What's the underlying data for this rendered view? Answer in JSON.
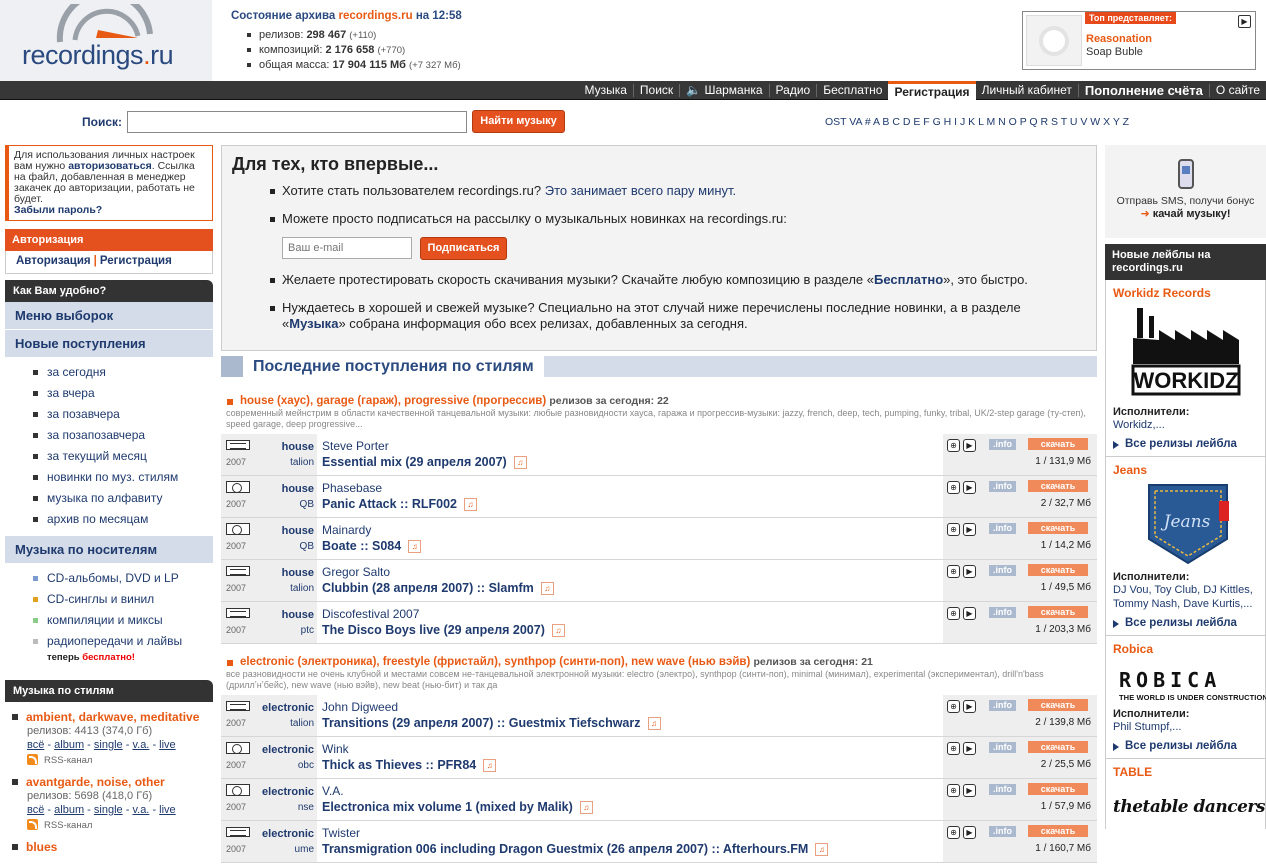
{
  "logo": {
    "text": "recordings",
    "dot": ".",
    "tld": "ru"
  },
  "archive": {
    "title_prefix": "Состояние архива",
    "site": "recordings.ru",
    "time_prefix": "на",
    "time": "12:58",
    "stats": [
      {
        "label": "релизов:",
        "value": "298 467",
        "delta": "(+110)"
      },
      {
        "label": "композиций:",
        "value": "2 176 658",
        "delta": "(+770)"
      },
      {
        "label": "общая масса:",
        "value": "17 904 115 Мб",
        "delta": "(+7 327 Мб)"
      }
    ]
  },
  "top": {
    "tag": "Топ представляет:",
    "artist": "Reasonation",
    "track": "Soap Buble"
  },
  "nav": {
    "items": [
      "Музыка",
      "Поиск",
      "Шарманка",
      "Радио",
      "Бесплатно",
      "Регистрация",
      "Личный кабинет",
      "Пополнение счёта",
      "О сайте"
    ],
    "selected": "Регистрация"
  },
  "search": {
    "label": "Поиск:",
    "value": "",
    "placeholder": "",
    "button": "Найти музыку",
    "alphabet": "OST VA # A B C D E F G H I J K L M N O P Q R S T U V W X Y Z"
  },
  "left": {
    "note_p1": "Для использования личных настроек вам нужно",
    "note_link": "авторизоваться",
    "note_p2": ". Ссылка на файл, добавленная в менеджер закачек до авторизации, работать не будет.",
    "forgot": "Забыли пароль?",
    "auth_head": "Авторизация",
    "auth_link1": "Авторизация",
    "auth_sep": "|",
    "auth_link2": "Регистрация",
    "how_head": "Как Вам удобно?",
    "menu": "Меню выборок",
    "new_head": "Новые поступления",
    "new_items": [
      "за сегодня",
      "за вчера",
      "за позавчера",
      "за позапозавчера",
      "за текущий месяц",
      "новинки по муз. стилям",
      "музыка по алфавиту",
      "архив по месяцам"
    ],
    "media_head": "Музыка по носителям",
    "media_items": [
      "CD-альбомы, DVD и LP",
      "CD-синглы и винил",
      "компиляции и миксы",
      "радиопередачи и лайвы"
    ],
    "free_prefix": "теперь",
    "free_word": "бесплатно!",
    "styles_head": "Музыка по стилям",
    "styles": [
      {
        "name": "ambient, darkwave, meditative",
        "meta": "релизов: 4413 (374,0 Гб)",
        "rss": "RSS-канал"
      },
      {
        "name": "avantgarde, noise, other",
        "meta": "релизов: 5698 (418,0 Гб)",
        "rss": "RSS-канал"
      },
      {
        "name": "blues",
        "meta": "",
        "rss": ""
      }
    ],
    "style_links": [
      "всё",
      "album",
      "single",
      "v.a.",
      "live"
    ],
    "style_link_sep": "-"
  },
  "welcome": {
    "title": "Для тех, кто впервые...",
    "b1_text": "Хотите стать пользователем recordings.ru?",
    "b1_link": "Это занимает всего пару минут.",
    "b2_text": "Можете просто подписаться на рассылку о музыкальных новинках на recordings.ru:",
    "email_placeholder": "Ваш e-mail",
    "subscribe": "Подписаться",
    "b3_p1": "Желаете протестировать скорость скачивания музыки? Скачайте любую композицию в разделе «",
    "b3_link": "Бесплатно",
    "b3_p2": "», это быстро.",
    "b4_p1": "Нуждаетесь в хорошей и свежей музыке? Специально на этот случай ниже перечислены последние новинки, а в разделе «",
    "b4_link": "Музыка",
    "b4_p2": "» собрана информация обо всех релизах, добавленных за сегодня."
  },
  "latest": {
    "title": "Последние поступления по стилям",
    "info_label": ".info",
    "download_label": "скачать",
    "genres": [
      {
        "title": "house (хаус), garage (гараж), progressive (прогрессив)",
        "count": "релизов за сегодня: 22",
        "desc": "современный мейнстрим в области качественной танцевальной музыки: любые разновидности хауса, гаража и прогрессив-музыки: jazzy, french, deep, tech, pumping, funky, tribal, UK/2-step garage (ту-степ), speed garage, deep progressive...",
        "releases": [
          {
            "media": "tape",
            "year": "2007",
            "genre": "house",
            "label": "talion",
            "artist": "Steve Porter",
            "title": "Essential mix (29 апреля 2007)",
            "size": "1 / 131,9 Мб"
          },
          {
            "media": "vinyl",
            "year": "2007",
            "genre": "house",
            "label": "QB",
            "artist": "Phasebase",
            "title": "Panic Attack :: RLF002",
            "size": "2 / 32,7 Мб"
          },
          {
            "media": "vinyl",
            "year": "2007",
            "genre": "house",
            "label": "QB",
            "artist": "Mainardy",
            "title": "Boate :: S084",
            "size": "1 / 14,2 Мб"
          },
          {
            "media": "tape",
            "year": "2007",
            "genre": "house",
            "label": "talion",
            "artist": "Gregor Salto",
            "title": "Clubbin (28 апреля 2007) :: Slamfm",
            "size": "1 / 49,5 Мб"
          },
          {
            "media": "tape",
            "year": "2007",
            "genre": "house",
            "label": "ptc",
            "artist": "Discofestival 2007",
            "title": "The Disco Boys live (29 апреля 2007)",
            "size": "1 / 203,3 Мб"
          }
        ]
      },
      {
        "title": "electronic (электроника), freestyle (фристайл), synthpop (синти-поп), new wave (нью вэйв)",
        "count": "релизов за сегодня: 21",
        "desc": "все разновидности не очень клубной и местами совсем не-танцевальной электронной музыки: electro (электро), synthpop (синти-поп), minimal (минимал), experimental (экспериментал), drill'n'bass (дриллʼнʼбейс), new wave (нью вэйв), new beat (нью-бит) и так да",
        "releases": [
          {
            "media": "tape",
            "year": "2007",
            "genre": "electronic",
            "label": "talion",
            "artist": "John Digweed",
            "title": "Transitions (29 апреля 2007) :: Guestmix Tiefschwarz",
            "size": "2 / 139,8 Мб"
          },
          {
            "media": "vinyl",
            "year": "2007",
            "genre": "electronic",
            "label": "obc",
            "artist": "Wink",
            "title": "Thick as Thieves :: PFR84",
            "size": "2 / 25,5 Мб"
          },
          {
            "media": "cd",
            "year": "2007",
            "genre": "electronic",
            "label": "nse",
            "artist": "V.A.",
            "title": "Electronica mix volume 1 (mixed by Malik)",
            "size": "1 / 57,9 Мб"
          },
          {
            "media": "tape",
            "year": "2007",
            "genre": "electronic",
            "label": "ume",
            "artist": "Twister",
            "title": "Transmigration 006 including Dragon Guestmix (26 апреля 2007) :: Afterhours.FM",
            "size": "1 / 160,7 Мб"
          }
        ]
      }
    ]
  },
  "right": {
    "sms_line1": "Отправь SMS, получи бонус",
    "sms_arrow": "➜",
    "sms_line2": "качай музыку!",
    "labels_head": "Новые лейблы на recordings.ru",
    "artists_label": "Исполнители:",
    "all_releases": "Все релизы лейбла",
    "labels": [
      {
        "name": "Workidz Records",
        "logo": "WORKIDZ",
        "artists": "Workidz,..."
      },
      {
        "name": "Jeans",
        "logo": "Jeans",
        "artists": "DJ Vou, Toy Club, DJ Kittles, Tommy Nash, Dave Kurtis,..."
      },
      {
        "name": "Robica",
        "logo": "ROBICA",
        "tagline": "THE WORLD IS UNDER CONSTRUCTION",
        "artists": "Phil Stumpf,..."
      },
      {
        "name": "TABLE",
        "logo": "thetable dancers"
      }
    ]
  },
  "colors": {
    "accent": "#e85a14",
    "link": "#1f3a6e",
    "nav_bg": "#373737",
    "section_bg": "#d3dce8"
  }
}
